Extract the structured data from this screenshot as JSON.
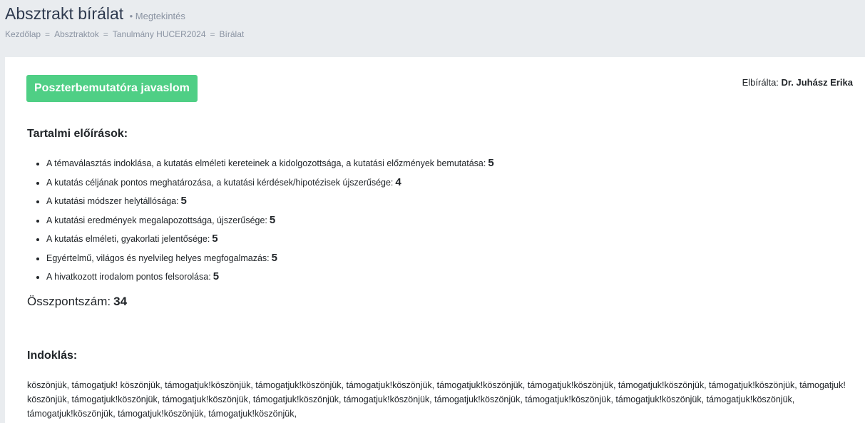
{
  "header": {
    "title": "Absztrakt bírálat",
    "subtitle": "• Megtekintés",
    "breadcrumb": [
      "Kezdőlap",
      "Absztraktok",
      "Tanulmány HUCER2024",
      "Bírálat"
    ],
    "breadcrumb_separator": "="
  },
  "review": {
    "status_label": "Poszterbemutatóra javaslom",
    "status_color": "#4fcf85",
    "reviewer_label": "Elbírálta:",
    "reviewer_name": "Dr. Juhász Erika"
  },
  "criteria": {
    "heading": "Tartalmi előírások:",
    "items": [
      {
        "label": "A témaválasztás indoklása, a kutatás elméleti kereteinek a kidolgozottsága, a kutatási előzmények bemutatása:",
        "score": "5"
      },
      {
        "label": "A kutatás céljának pontos meghatározása, a kutatási kérdések/hipotézisek újszerűsége:",
        "score": "4"
      },
      {
        "label": "A kutatási módszer helytállósága:",
        "score": "5"
      },
      {
        "label": "A kutatási eredmények megalapozottsága, újszerűsége:",
        "score": "5"
      },
      {
        "label": "A kutatás elméleti, gyakorlati jelentősége:",
        "score": "5"
      },
      {
        "label": "Egyértelmű, világos és nyelvileg helyes megfogalmazás:",
        "score": "5"
      },
      {
        "label": "A hivatkozott irodalom pontos felsorolása:",
        "score": "5"
      }
    ]
  },
  "total": {
    "label": "Összpontszám:",
    "value": "34"
  },
  "justification": {
    "heading": "Indoklás:",
    "text": "köszönjük, támogatjuk! köszönjük, támogatjuk!köszönjük, támogatjuk!köszönjük, támogatjuk!köszönjük, támogatjuk!köszönjük, támogatjuk!köszönjük, támogatjuk!köszönjük, támogatjuk!köszönjük, támogatjuk! köszönjük, támogatjuk!köszönjük, támogatjuk!köszönjük, támogatjuk!köszönjük, támogatjuk!köszönjük, támogatjuk!köszönjük, támogatjuk!köszönjük, támogatjuk!köszönjük, támogatjuk!köszönjük, támogatjuk!köszönjük, támogatjuk!köszönjük, támogatjuk!köszönjük,"
  }
}
